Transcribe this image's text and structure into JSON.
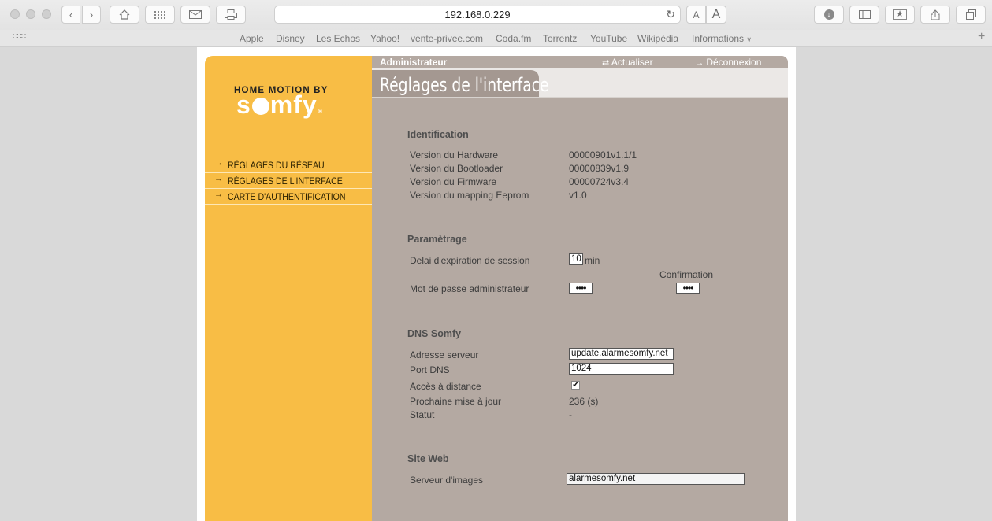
{
  "browser": {
    "url": "192.168.0.229",
    "bookmarks": [
      "Apple",
      "Disney",
      "Les Echos",
      "Yahoo!",
      "vente-privee.com",
      "Coda.fm",
      "Torrentz",
      "YouTube",
      "Wikipédia",
      "Informations"
    ],
    "text_small_label": "A",
    "text_large_label": "A"
  },
  "brand": {
    "tagline": "HOME MOTION BY",
    "logo": "somfy"
  },
  "menu": [
    {
      "label": "RÉGLAGES DU RÉSEAU"
    },
    {
      "label": "RÉGLAGES DE L'INTERFACE"
    },
    {
      "label": "CARTE D'AUTHENTIFICATION"
    }
  ],
  "topbar": {
    "admin": "Administrateur",
    "refresh": "Actualiser",
    "logout": "Déconnexion"
  },
  "page_title": "Réglages de l'interface",
  "identification": {
    "title": "Identification",
    "rows": [
      {
        "label": "Version du Hardware",
        "value": "00000901v1.1/1"
      },
      {
        "label": "Version du Bootloader",
        "value": "00000839v1.9"
      },
      {
        "label": "Version du Firmware",
        "value": "00000724v3.4"
      },
      {
        "label": "Version du mapping Eeprom",
        "value": "v1.0"
      }
    ]
  },
  "parametrage": {
    "title": "Paramètrage",
    "session_label": "Delai d'expiration de session",
    "session_value": "10",
    "session_unit": "min",
    "confirmation_label": "Confirmation",
    "password_label": "Mot de passe administrateur",
    "password_mask": "••••",
    "confirmation_mask": "••••"
  },
  "dns": {
    "title": "DNS Somfy",
    "server_label": "Adresse serveur",
    "server_value": "update.alarmesomfy.net",
    "port_label": "Port DNS",
    "port_value": "1024",
    "remote_label": "Accès à distance",
    "remote_checked": true,
    "next_update_label": "Prochaine mise à jour",
    "next_update_value": "236 (s)",
    "status_label": "Statut",
    "status_value": "-"
  },
  "website": {
    "title": "Site Web",
    "image_server_label": "Serveur d'images",
    "image_server_value": "alarmesomfy.net"
  }
}
